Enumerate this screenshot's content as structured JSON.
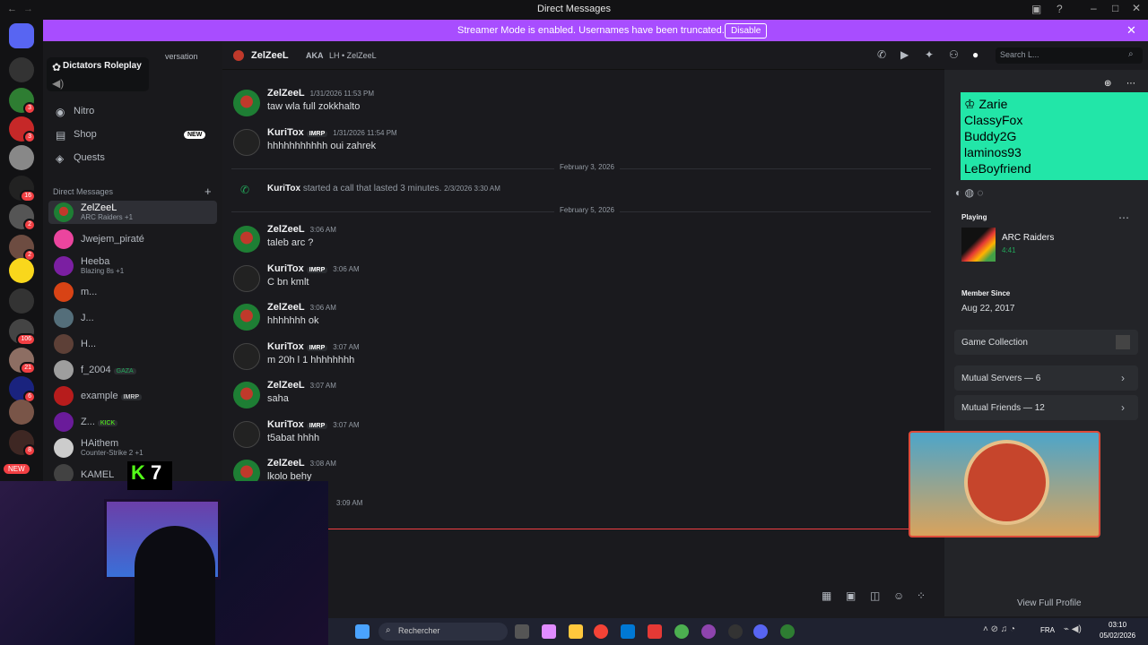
{
  "window": {
    "title": "Direct Messages"
  },
  "banner": {
    "text": "Streamer Mode is enabled. Usernames have been truncated.",
    "button": "Disable"
  },
  "popup": {
    "server": "Dictators Roleplay",
    "tooltip_fragment": "versation"
  },
  "nav": {
    "nitro": "Nitro",
    "shop": "Shop",
    "shop_badge": "NEW",
    "quests": "Quests",
    "dm_header": "Direct Messages",
    "add": "+"
  },
  "dms": [
    {
      "name": "ZelZeeL",
      "sub": "ARC Raiders +1"
    },
    {
      "name": "Jwejem_piraté",
      "sub": ""
    },
    {
      "name": "Heeba",
      "sub": "Blazing 8s +1"
    },
    {
      "name": "m...",
      "sub": ""
    },
    {
      "name": "J...",
      "sub": ""
    },
    {
      "name": "H...",
      "sub": ""
    },
    {
      "name": "f_2004",
      "sub": "",
      "tag": "GAZA"
    },
    {
      "name": "example",
      "sub": "",
      "tag": "IMRP"
    },
    {
      "name": "Z...",
      "sub": "",
      "tag": "KICK"
    },
    {
      "name": "HAithem",
      "sub": "Counter-Strike 2 +1"
    },
    {
      "name": "KAMEL",
      "sub": ""
    }
  ],
  "server_badges": [
    "3",
    "3",
    "16",
    "2",
    "2",
    "106",
    "21",
    "6",
    "8",
    "NEW"
  ],
  "chat_header": {
    "name": "ZelZeeL",
    "aka": "AKA",
    "aka_value": "LH • ZelZeeL",
    "search": "Search L..."
  },
  "messages": [
    {
      "author": "ZelZeeL",
      "tag": "",
      "time": "1/31/2026 11:53 PM",
      "body": "taw wla full zokkhalto"
    },
    {
      "author": "KuriTox",
      "tag": "IMRP",
      "time": "1/31/2026 11:54 PM",
      "body": "hhhhhhhhhhh oui zahrek"
    },
    {
      "divider": "February 3, 2026"
    },
    {
      "call": "started a call that lasted 3 minutes.",
      "author": "KuriTox",
      "time": "2/3/2026 3:30 AM"
    },
    {
      "divider": "February 5, 2026"
    },
    {
      "author": "ZelZeeL",
      "tag": "",
      "time": "3:06 AM",
      "body": "taleb arc ?"
    },
    {
      "author": "KuriTox",
      "tag": "IMRP",
      "time": "3:06 AM",
      "body": "C bn kmlt"
    },
    {
      "author": "ZelZeeL",
      "tag": "",
      "time": "3:06 AM",
      "body": "hhhhhhh ok"
    },
    {
      "author": "KuriTox",
      "tag": "IMRP",
      "time": "3:07 AM",
      "body": "m 20h l 1 hhhhhhhh"
    },
    {
      "author": "ZelZeeL",
      "tag": "",
      "time": "3:07 AM",
      "body": "saha"
    },
    {
      "author": "KuriTox",
      "tag": "IMRP",
      "time": "3:07 AM",
      "body": "t5abat hhhh"
    },
    {
      "author": "ZelZeeL",
      "tag": "",
      "time": "3:08 AM",
      "body": "lkolo behy"
    },
    {
      "time_only": "3:09 AM"
    }
  ],
  "streamer_overlay": [
    "Zarie",
    "ClassyFox",
    "Buddy2G",
    "laminos93",
    "LeBoyfriend"
  ],
  "webcam_label": "7",
  "profile": {
    "playing_label": "Playing",
    "game": "ARC Raiders",
    "game_time": "4:41",
    "member_since_label": "Member Since",
    "member_since": "Aug 22, 2017",
    "game_collection": "Game Collection",
    "mutual_servers": "Mutual Servers — 6",
    "mutual_friends": "Mutual Friends — 12",
    "view_full": "View Full Profile"
  },
  "taskbar": {
    "search": "Rechercher",
    "lang": "FRA",
    "time": "03:10",
    "date": "05/02/2026"
  },
  "colors": {
    "accent": "#a84dff",
    "streamer": "#22e6a8",
    "discord": "#5865f2"
  }
}
